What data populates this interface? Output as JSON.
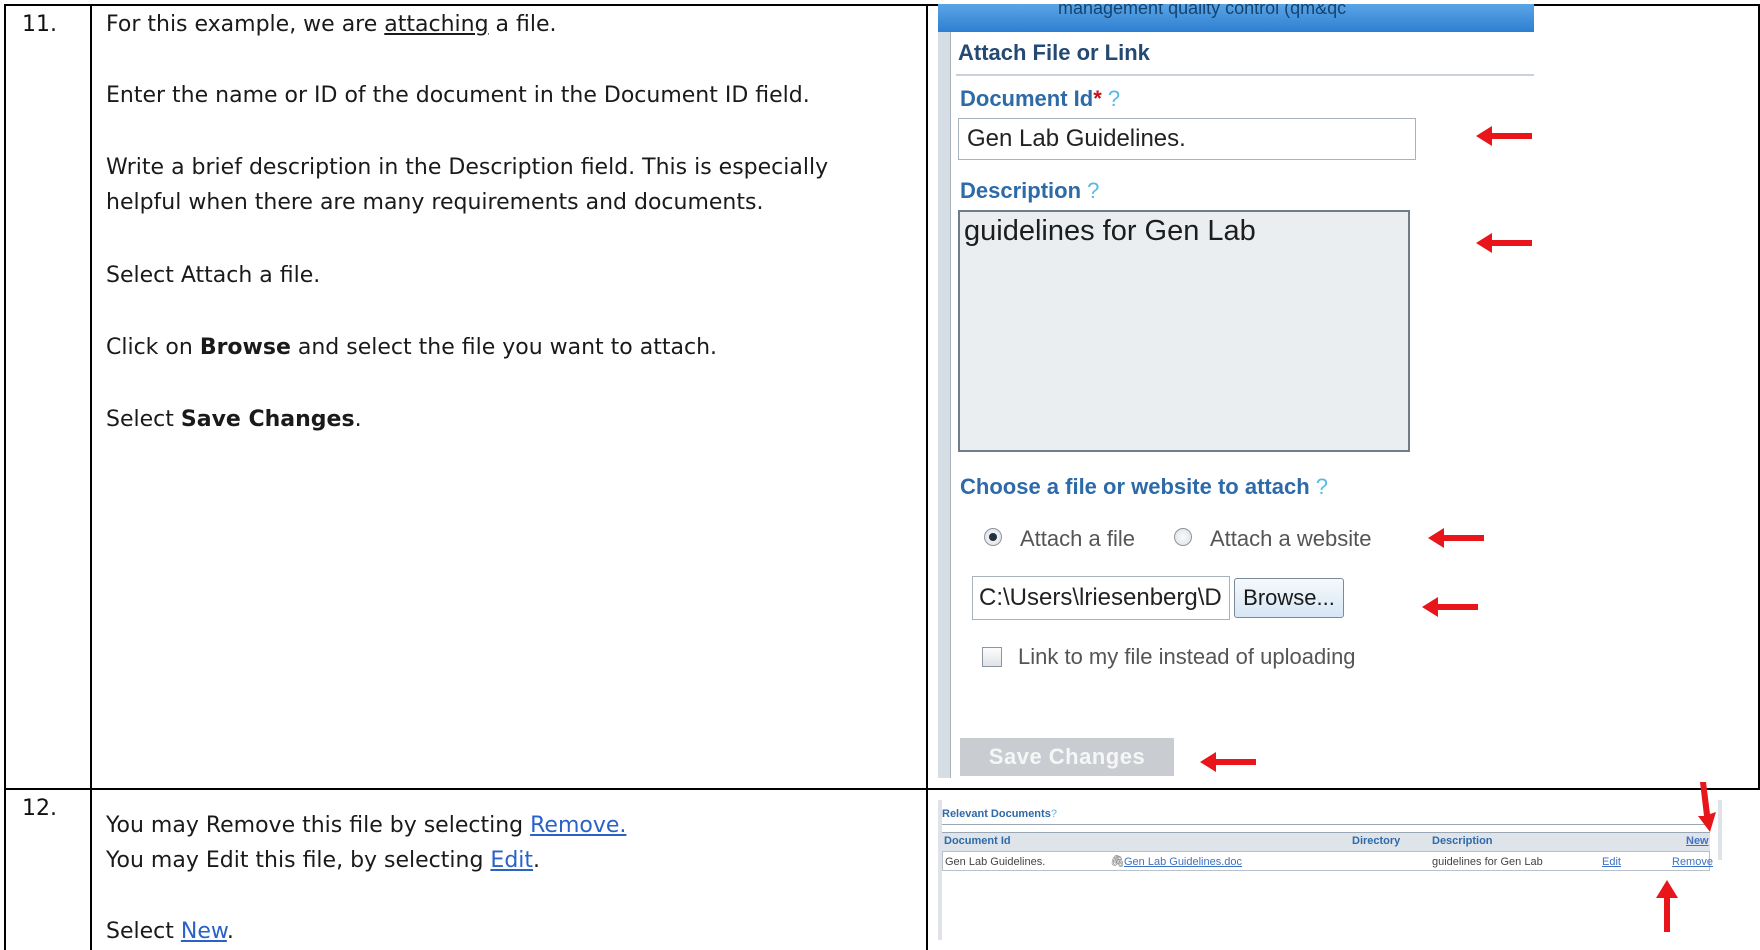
{
  "steps": [
    {
      "number": "11.",
      "lines": {
        "l1_pre": "For this example, we are ",
        "l1_u": "attaching",
        "l1_post": " a file.",
        "l2": "Enter the name or ID of the document in the Document ID field.",
        "l3": "Write a brief description in the Description field.  This is especially",
        "l4": "helpful when there are many requirements and documents.",
        "l5": "Select Attach a file.",
        "l6_pre": "Click on ",
        "l6_b": "Browse",
        "l6_post": " and select the file you want to attach.",
        "l7_pre": "Select ",
        "l7_b": "Save Changes",
        "l7_post": "."
      }
    },
    {
      "number": "12.",
      "lines": {
        "l1_pre": "You may Remove this file by selecting ",
        "l1_link": "Remove.",
        "l2_pre": "You may Edit this file, by selecting ",
        "l2_link": "Edit",
        "l2_post": ".",
        "l3_pre": "Select ",
        "l3_link": "New",
        "l3_post": "."
      }
    }
  ],
  "dialog": {
    "top_strip_text": "management quality control (qm&qc",
    "title": "Attach File or Link",
    "document_id_label": "Document Id",
    "required_mark": "*",
    "help_mark": "?",
    "document_id_value": "Gen Lab Guidelines.",
    "description_label": "Description",
    "description_value": "guidelines for Gen Lab",
    "choose_label": "Choose a file or website to attach",
    "radio_file": "Attach a file",
    "radio_website": "Attach a website",
    "file_path_value": "C:\\Users\\lriesenberg\\D",
    "browse_label": "Browse...",
    "link_checkbox_label": "Link to my file instead of uploading",
    "save_label": "Save Changes"
  },
  "relevant_documents": {
    "title": "Relevant Documents",
    "help_mark": "?",
    "columns": [
      "Document Id",
      "Directory",
      "Description"
    ],
    "new_label": "New",
    "rows": [
      {
        "document_id": "Gen Lab Guidelines.",
        "file_link": "Gen Lab Guidelines.doc",
        "description": "guidelines for Gen Lab",
        "edit": "Edit",
        "remove": "Remove"
      }
    ]
  },
  "colors": {
    "arrow": "#e8151b",
    "label_blue": "#2d6aa8",
    "link_blue": "#2a62c9"
  }
}
